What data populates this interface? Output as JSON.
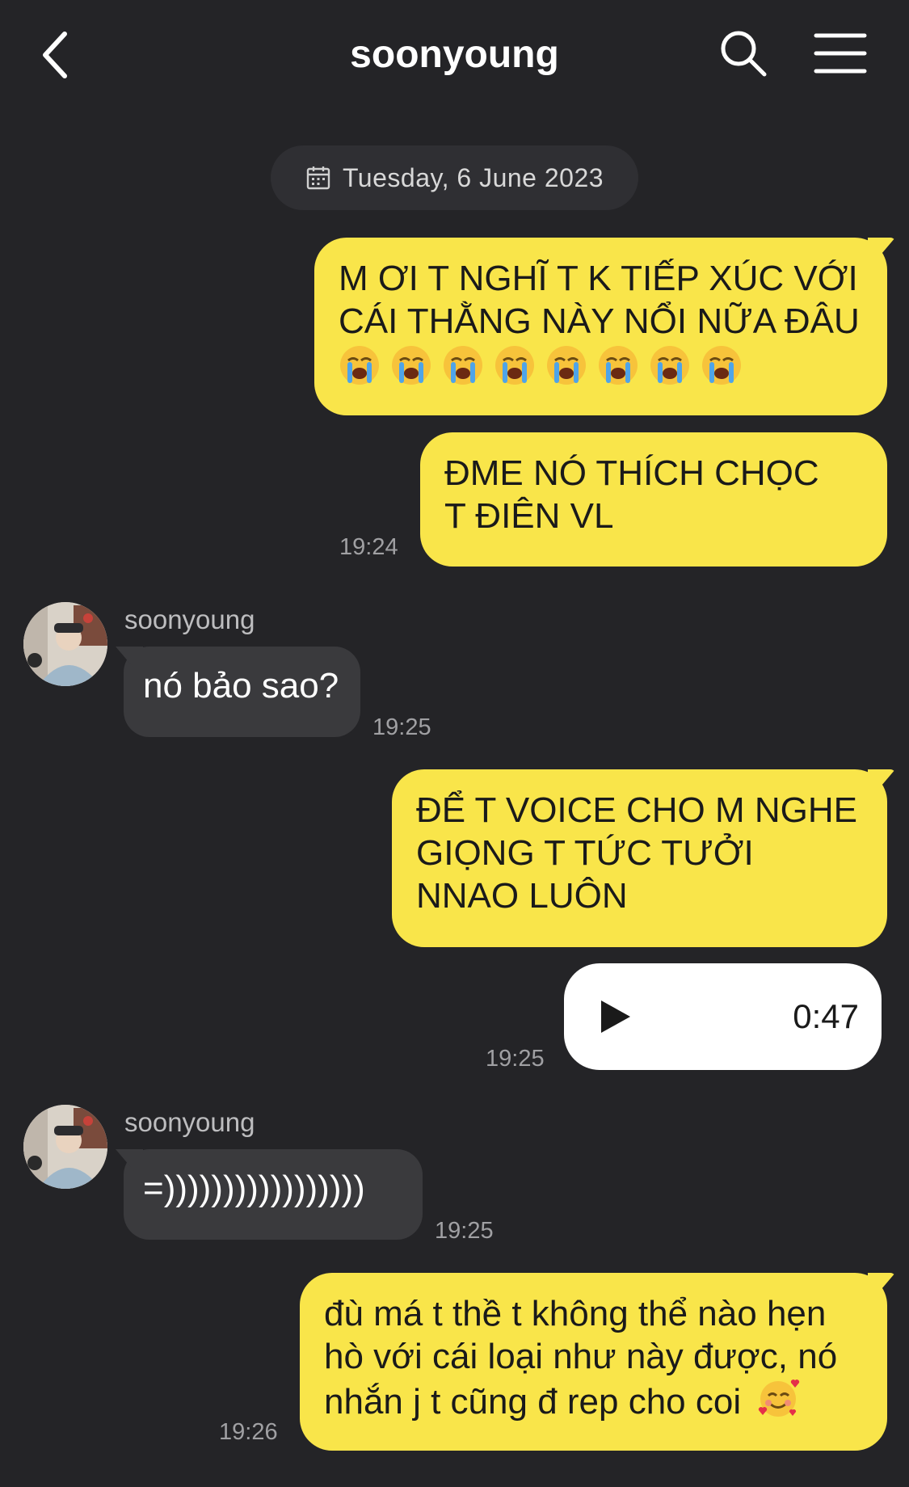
{
  "header": {
    "title": "soonyoung",
    "back_icon": "chevron-left-icon",
    "search_icon": "search-icon",
    "menu_icon": "hamburger-menu-icon"
  },
  "date_separator": {
    "icon": "calendar-icon",
    "label": "Tuesday, 6 June 2023"
  },
  "colors": {
    "background": "#242427",
    "outgoing_bubble": "#f9e54a",
    "incoming_bubble": "#3a3a3d",
    "voice_bubble": "#ffffff"
  },
  "messages": [
    {
      "direction": "out",
      "text": "M ƠI T NGHĨ T K TIẾP XÚC VỚI CÁI THẰNG NÀY NỔI NỮA ĐÂU",
      "emoji": "loudly-crying-face x8"
    },
    {
      "direction": "out",
      "text": "ĐME NÓ THÍCH CHỌC T ĐIÊN VL",
      "time": "19:24"
    },
    {
      "direction": "in",
      "sender": "soonyoung",
      "text": "nó bảo sao?",
      "time": "19:25"
    },
    {
      "direction": "out",
      "text": "ĐỂ T VOICE CHO M NGHE GIỌNG T TỨC TƯỞI NNAO LUÔN"
    },
    {
      "direction": "out",
      "type": "voice",
      "icon": "play-icon",
      "duration": "0:47",
      "time": "19:25"
    },
    {
      "direction": "in",
      "sender": "soonyoung",
      "text": "=)))))))))))))))))",
      "time": "19:25"
    },
    {
      "direction": "out",
      "text": "đù má t thề t không thể nào hẹn hò với cái loại như này được, nó nhắn j t cũng đ rep cho coi",
      "emoji": "smiling-face-with-hearts",
      "time": "19:26"
    }
  ]
}
